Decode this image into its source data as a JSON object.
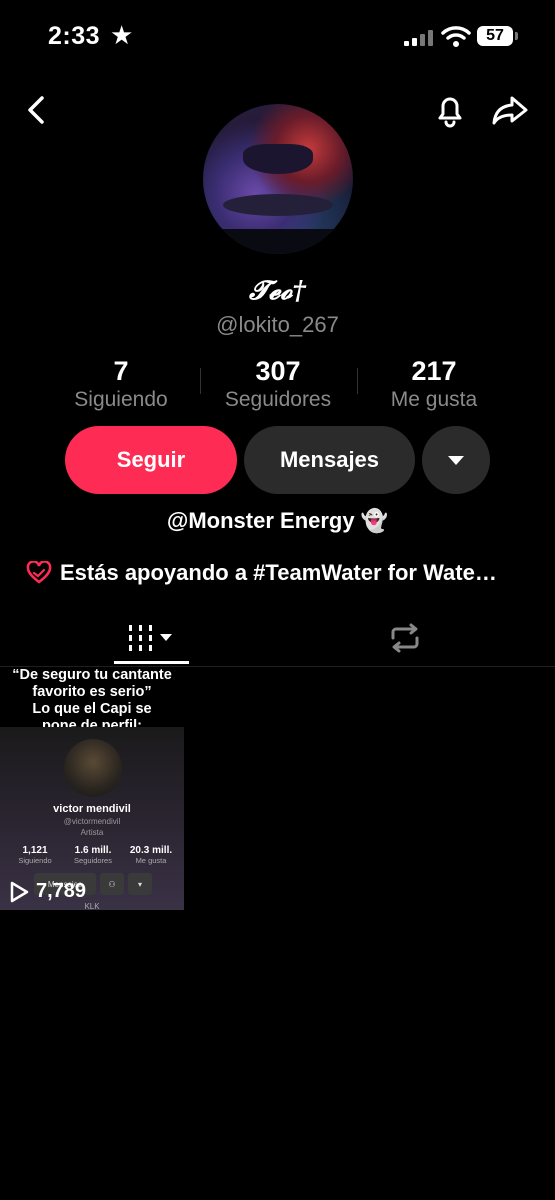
{
  "status_bar": {
    "time": "2:33",
    "battery": "57"
  },
  "profile": {
    "display_name": "𝓣𝓮𝓸†",
    "handle": "@lokito_267",
    "stats": [
      {
        "value": "7",
        "label": "Siguiendo"
      },
      {
        "value": "307",
        "label": "Seguidores"
      },
      {
        "value": "217",
        "label": "Me gusta"
      }
    ],
    "bio": "@Monster Energy 👻",
    "support_text": "Estás apoyando a #TeamWater for Wate…"
  },
  "actions": {
    "follow_label": "Seguir",
    "message_label": "Mensajes"
  },
  "tabs": [
    {
      "icon": "videos-grid-icon",
      "active": true
    },
    {
      "icon": "repost-icon",
      "active": false
    }
  ],
  "videos": [
    {
      "caption_line1": "“De seguro tu cantante",
      "caption_line2": "favorito es serio”",
      "caption_line3": "Lo que el Capi se",
      "caption_line4": "pone de perfil:",
      "inner": {
        "name": "victor mendivil",
        "handle": "@victormendivil",
        "role": "Artista",
        "stats": [
          {
            "value": "1,121",
            "label": "Siguiendo"
          },
          {
            "value": "1.6 mill.",
            "label": "Seguidores"
          },
          {
            "value": "20.3 mill.",
            "label": "Me gusta"
          }
        ],
        "button": "Mensajes",
        "footer": "KLK"
      },
      "plays": "7,789"
    }
  ]
}
